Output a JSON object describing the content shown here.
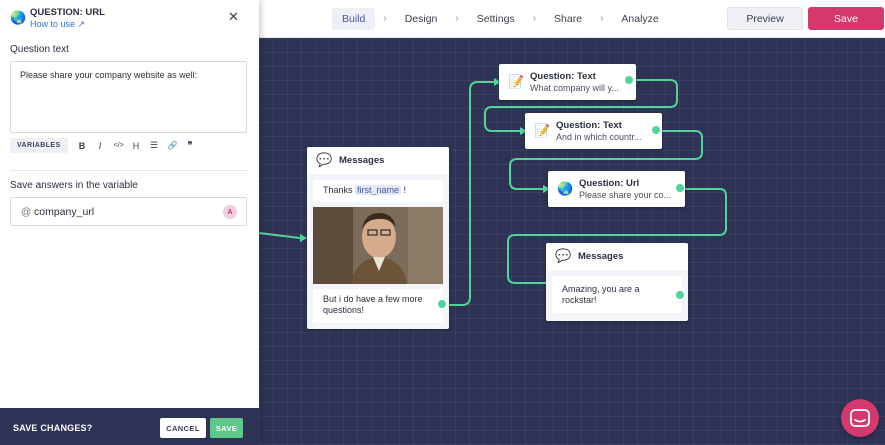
{
  "panel": {
    "icon": "globe-icon",
    "title": "QUESTION: URL",
    "how_to_use": "How to use",
    "question_label": "Question text",
    "question_value": "Please share your company website as well:",
    "toolbar": {
      "variables": "VARIABLES",
      "bold": "B",
      "italic": "I",
      "code": "</>",
      "heading": "H",
      "list": "☰",
      "link": "🔗",
      "quote": "❞"
    },
    "variable_label": "Save answers in the variable",
    "variable_prefix": "@",
    "variable_value": "company_url",
    "variable_avatar": "A",
    "save_question": "SAVE CHANGES?",
    "cancel": "CANCEL",
    "save": "SAVE"
  },
  "topbar": {
    "steps": [
      "Build",
      "Design",
      "Settings",
      "Share",
      "Analyze"
    ],
    "active_step": "Build",
    "preview": "Preview",
    "save": "Save"
  },
  "flow": {
    "messages1": {
      "title": "Messages",
      "text_before": "Thanks ",
      "variable": "first_name",
      "text_after": " !",
      "closing": "But i do have a few more questions!"
    },
    "q_text1": {
      "title": "Question: Text",
      "subtitle": "What company will y..."
    },
    "q_text2": {
      "title": "Question: Text",
      "subtitle": "And in which countr..."
    },
    "q_url": {
      "title": "Question: Url",
      "subtitle": "Please share your co..."
    },
    "messages2": {
      "title": "Messages",
      "text": "Amazing, you are a rockstar!"
    }
  },
  "colors": {
    "accent": "#d4386c",
    "connector": "#53d39a",
    "canvas": "#2e3355",
    "link": "#3b6fd4"
  }
}
